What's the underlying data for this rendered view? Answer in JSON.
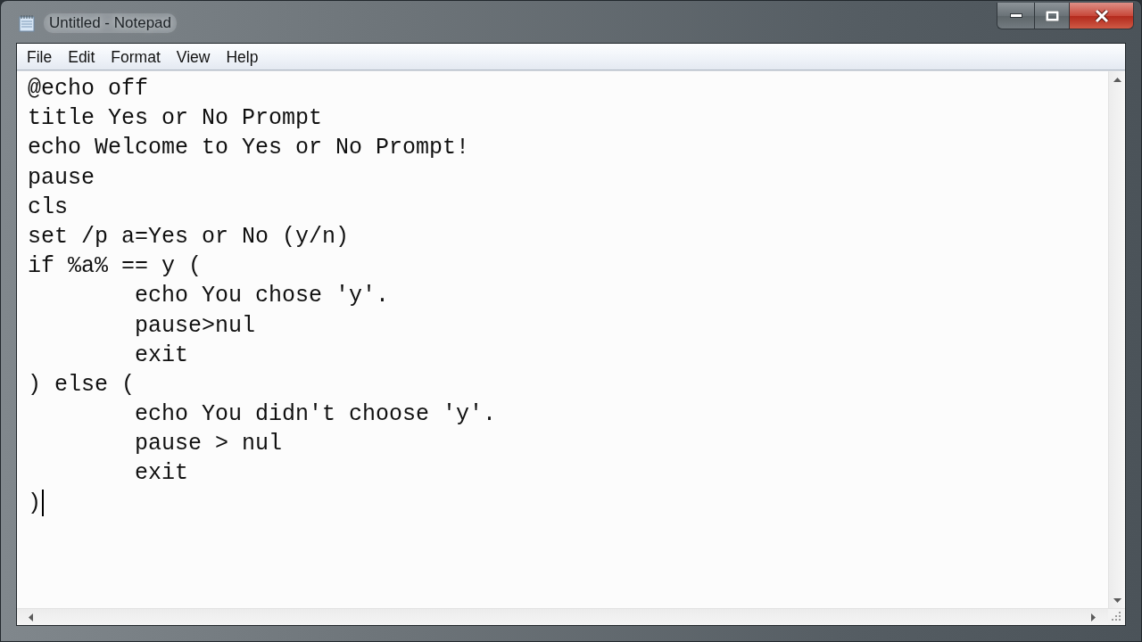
{
  "window": {
    "title": "Untitled - Notepad",
    "controls": [
      {
        "kind": "minimize"
      },
      {
        "kind": "maximize"
      },
      {
        "kind": "close"
      }
    ]
  },
  "menu": [
    "File",
    "Edit",
    "Format",
    "View",
    "Help"
  ],
  "editor": {
    "lines": [
      {
        "text": "@echo off",
        "cursor": false
      },
      {
        "text": "title Yes or No Prompt",
        "cursor": false
      },
      {
        "text": "echo Welcome to Yes or No Prompt!",
        "cursor": false
      },
      {
        "text": "pause",
        "cursor": false
      },
      {
        "text": "cls",
        "cursor": false
      },
      {
        "text": "set /p a=Yes or No (y/n)",
        "cursor": false
      },
      {
        "text": "if %a% == y (",
        "cursor": false
      },
      {
        "text": "\techo You chose 'y'.",
        "cursor": false
      },
      {
        "text": "\tpause>nul",
        "cursor": false
      },
      {
        "text": "\texit",
        "cursor": false
      },
      {
        "text": ") else (",
        "cursor": false
      },
      {
        "text": "\techo You didn't choose 'y'.",
        "cursor": false
      },
      {
        "text": "\tpause > nul",
        "cursor": false
      },
      {
        "text": "\texit",
        "cursor": false
      },
      {
        "text": ")",
        "cursor": true
      }
    ]
  }
}
